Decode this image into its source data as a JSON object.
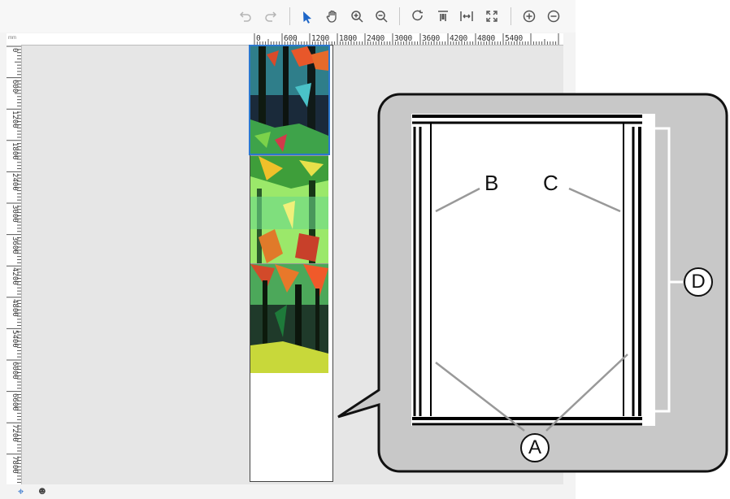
{
  "toolbar": {
    "undo_icon": "undo-icon",
    "redo_icon": "redo-icon",
    "select_icon": "select-arrow-icon",
    "pan_icon": "hand-pan-icon",
    "zoom_in_icon": "zoom-in-icon",
    "zoom_out_icon": "zoom-out-icon",
    "rotate_icon": "rotate-icon",
    "align_top_icon": "align-top-icon",
    "fit_width_icon": "fit-width-icon",
    "fit_page_icon": "fit-page-icon",
    "add_icon": "add-icon",
    "remove_icon": "remove-icon"
  },
  "ruler": {
    "unit": "mm",
    "h_labels": [
      "0",
      "600",
      "1200",
      "1800",
      "2400",
      "3000",
      "3600",
      "4200",
      "4800",
      "5400"
    ],
    "v_labels": [
      "0",
      "600",
      "1200",
      "1800",
      "2400",
      "3000",
      "3600",
      "4200",
      "4800",
      "5400",
      "6000",
      "6600",
      "7200",
      "7800"
    ]
  },
  "status_bar": {
    "locate_icon": "crosshair-icon",
    "user_icon": "user-icon"
  },
  "callout": {
    "label_a": "A",
    "label_b": "B",
    "label_c": "C",
    "label_d": "D"
  },
  "colors": {
    "selection": "#2b78d0",
    "callout_bg": "#c8c8c8",
    "canvas_bg": "#e6e6e6"
  }
}
